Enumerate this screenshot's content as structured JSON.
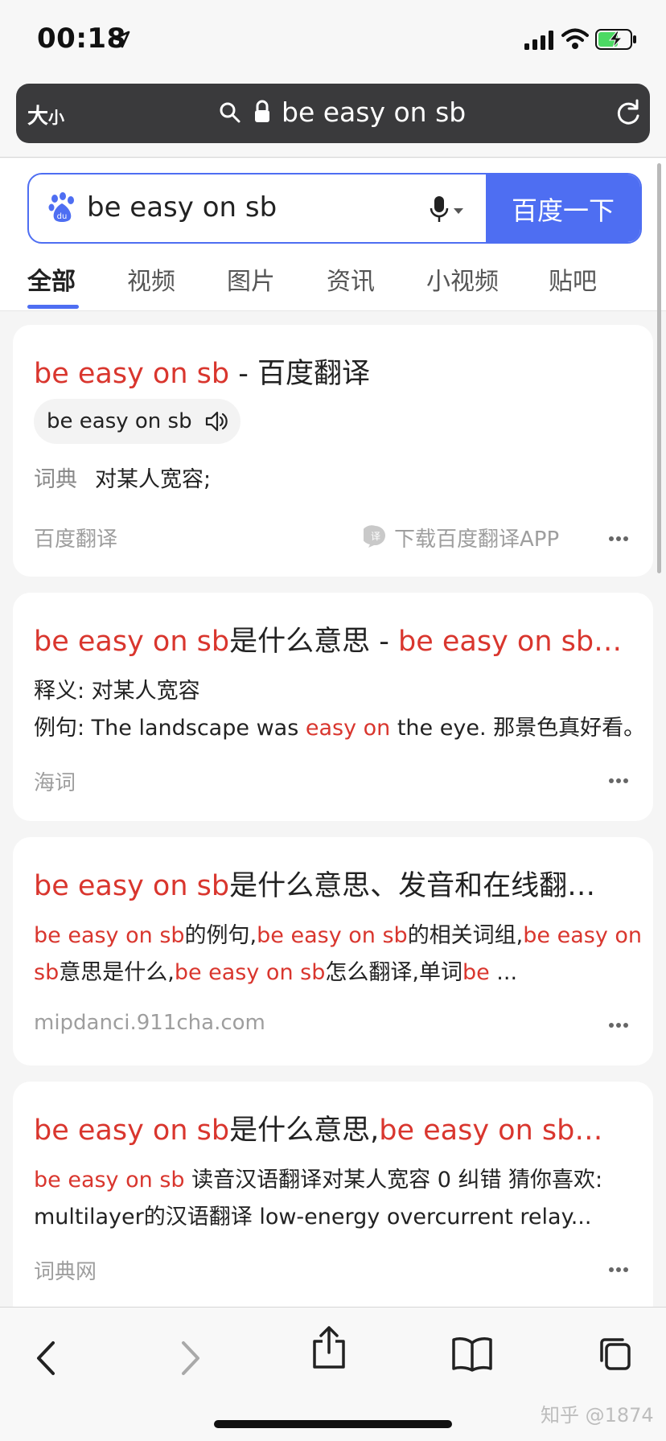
{
  "status_bar": {
    "time": "00:18"
  },
  "address_bar": {
    "text_size_big": "大",
    "text_size_small": "小",
    "url_text": "be easy on sb"
  },
  "search": {
    "query": "be easy on sb",
    "button_label": "百度一下"
  },
  "tabs": [
    {
      "label": "全部"
    },
    {
      "label": "视频"
    },
    {
      "label": "图片"
    },
    {
      "label": "资讯"
    },
    {
      "label": "小视频"
    },
    {
      "label": "贴吧"
    }
  ],
  "results": [
    {
      "title_hl": "be easy on sb",
      "title_rest": " - 百度翻译",
      "pron_word": "be easy on sb",
      "dict_label": "词典",
      "dict_meaning": "对某人宽容;",
      "source": "百度翻译",
      "app_link": "下载百度翻译APP"
    },
    {
      "title_hl1": "be easy on sb",
      "title_mid": "是什么意思 - ",
      "title_hl2": "be easy on sb…",
      "line1": "释义: 对某人宽容",
      "line2_a": "例句: The landscape was ",
      "line2_hl": "easy on",
      "line2_b": " the eye. 那景色真好看。",
      "source": "海词"
    },
    {
      "title_hl": "be easy on sb",
      "title_rest": "是什么意思、发音和在线翻…",
      "l1_hl1": "be easy on sb",
      "l1_t1": "的例句,",
      "l1_hl2": "be easy on sb",
      "l1_t2": "的相关词组,",
      "l1_hl3": "be easy on",
      "l2_hl1": "sb",
      "l2_t1": "意思是什么,",
      "l2_hl2": "be easy on sb",
      "l2_t2": "怎么翻译,单词",
      "l2_hl3": "be",
      "l2_t3": " ...",
      "source": "mipdanci.911cha.com"
    },
    {
      "title_hl1": "be easy on sb",
      "title_mid": "是什么意思,",
      "title_hl2": "be easy on sb…",
      "l1_hl": "be easy on sb",
      "l1_rest": " 读音汉语翻译对某人宽容 0 纠错 猜你喜欢:",
      "l2": "multilayer的汉语翻译 low-energy overcurrent relay...",
      "source": "词典网"
    }
  ],
  "watermark": "知乎 @1874",
  "colors": {
    "accent": "#4e6ef2",
    "highlight": "#d9362e"
  }
}
